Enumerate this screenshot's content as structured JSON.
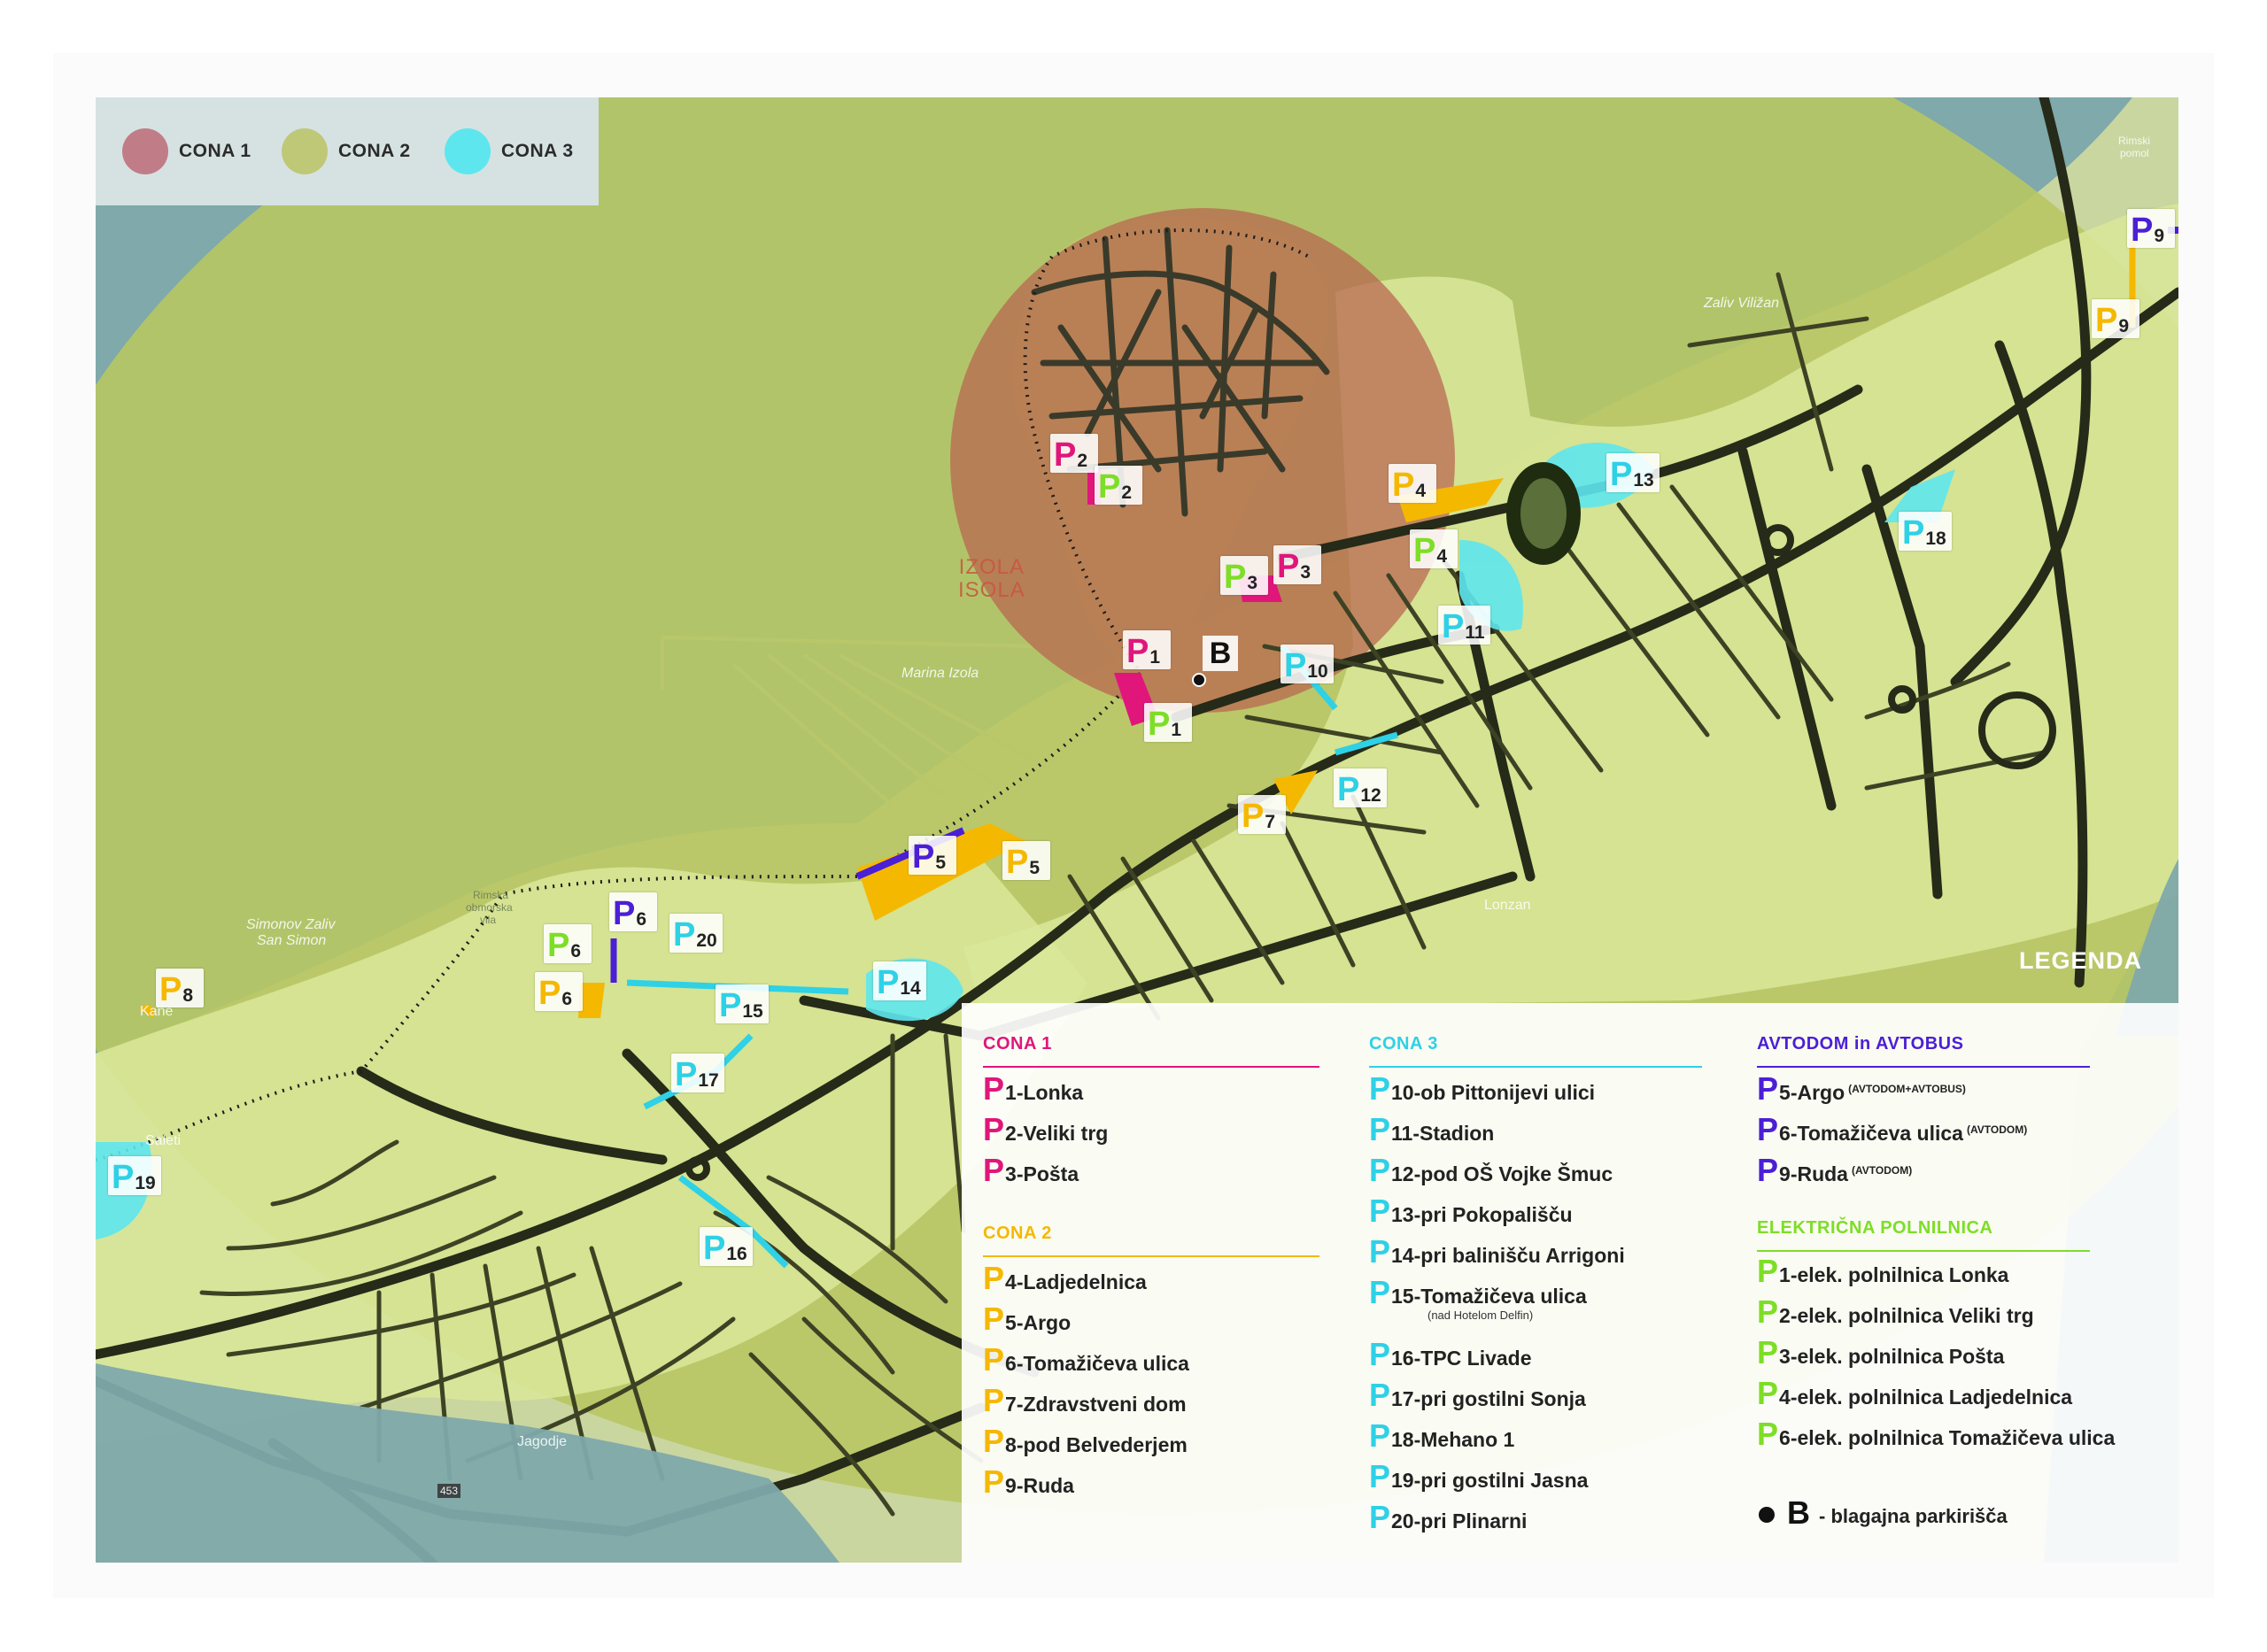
{
  "colors": {
    "sea": "#7fa9ab",
    "zone1": "#c07d88",
    "zone2": "#b8c763",
    "zone3": "#5ee6ee",
    "land": "#d9e89a",
    "cona1_accent": "#e0167b",
    "cona2_accent": "#f5b800",
    "cona3_accent": "#2ed1e6",
    "avtodom_accent": "#4b1fd6",
    "elec_accent": "#7dde26"
  },
  "zone_legend": [
    {
      "label": "CONA 1",
      "color": "#c07d88"
    },
    {
      "label": "CONA 2",
      "color": "#bfc877"
    },
    {
      "label": "CONA 3",
      "color": "#5ee6ee"
    }
  ],
  "legend_title": "LEGENDA",
  "places": {
    "izola": "IZOLA",
    "isola": "ISOLA",
    "marina": "Marina Izola",
    "zaliv_vilizan": "Zaliv Viližan",
    "simonov_zaliv": "Simonov Zaliv",
    "san_simon": "San Simon",
    "jagodje": "Jagodje",
    "kane": "Kane",
    "saleti": "Saleti",
    "lonzan": "Lonzan",
    "rimski_pomol_1": "Rimski",
    "rimski_pomol_2": "pomol",
    "rimska_vila_1": "Rimska",
    "rimska_vila_2": "obmorska",
    "rimska_vila_3": "vila",
    "road_453": "453"
  },
  "map_pins": [
    {
      "id": "cona1-1",
      "num": "1",
      "color": "#e0167b"
    },
    {
      "id": "cona1-2",
      "num": "2",
      "color": "#e0167b"
    },
    {
      "id": "cona1-3",
      "num": "3",
      "color": "#e0167b"
    },
    {
      "id": "elec-1",
      "num": "1",
      "color": "#7dde26"
    },
    {
      "id": "elec-2",
      "num": "2",
      "color": "#7dde26"
    },
    {
      "id": "elec-3",
      "num": "3",
      "color": "#7dde26"
    },
    {
      "id": "elec-4",
      "num": "4",
      "color": "#7dde26"
    },
    {
      "id": "elec-6",
      "num": "6",
      "color": "#7dde26"
    },
    {
      "id": "cona2-4",
      "num": "4",
      "color": "#f5b800"
    },
    {
      "id": "cona2-5",
      "num": "5",
      "color": "#f5b800"
    },
    {
      "id": "cona2-6",
      "num": "6",
      "color": "#f5b800"
    },
    {
      "id": "cona2-7",
      "num": "7",
      "color": "#f5b800"
    },
    {
      "id": "cona2-8",
      "num": "8",
      "color": "#f5b800"
    },
    {
      "id": "cona2-9",
      "num": "9",
      "color": "#f5b800"
    },
    {
      "id": "avto-5",
      "num": "5",
      "color": "#4b1fd6"
    },
    {
      "id": "avto-6",
      "num": "6",
      "color": "#4b1fd6"
    },
    {
      "id": "avto-9",
      "num": "9",
      "color": "#4b1fd6"
    },
    {
      "id": "cona3-10",
      "num": "10",
      "color": "#2ed1e6"
    },
    {
      "id": "cona3-11",
      "num": "11",
      "color": "#2ed1e6"
    },
    {
      "id": "cona3-12",
      "num": "12",
      "color": "#2ed1e6"
    },
    {
      "id": "cona3-13",
      "num": "13",
      "color": "#2ed1e6"
    },
    {
      "id": "cona3-14",
      "num": "14",
      "color": "#2ed1e6"
    },
    {
      "id": "cona3-15",
      "num": "15",
      "color": "#2ed1e6"
    },
    {
      "id": "cona3-16",
      "num": "16",
      "color": "#2ed1e6"
    },
    {
      "id": "cona3-17",
      "num": "17",
      "color": "#2ed1e6"
    },
    {
      "id": "cona3-18",
      "num": "18",
      "color": "#2ed1e6"
    },
    {
      "id": "cona3-19",
      "num": "19",
      "color": "#2ed1e6"
    },
    {
      "id": "cona3-20",
      "num": "20",
      "color": "#2ed1e6"
    }
  ],
  "cash_desk_marker": "B",
  "legend": {
    "cona1": {
      "title": "CONA 1",
      "color": "#e0167b",
      "items": [
        {
          "num": "1",
          "name": "-Lonka"
        },
        {
          "num": "2",
          "name": "-Veliki trg"
        },
        {
          "num": "3",
          "name": "-Pošta"
        }
      ]
    },
    "cona2": {
      "title": "CONA 2",
      "color": "#f5b800",
      "items": [
        {
          "num": "4",
          "name": "-Ladjedelnica"
        },
        {
          "num": "5",
          "name": "-Argo"
        },
        {
          "num": "6",
          "name": "-Tomažičeva ulica"
        },
        {
          "num": "7",
          "name": "-Zdravstveni dom"
        },
        {
          "num": "8",
          "name": "-pod Belvederjem"
        },
        {
          "num": "9",
          "name": "-Ruda"
        }
      ]
    },
    "cona3": {
      "title": "CONA 3",
      "color": "#2ed1e6",
      "items": [
        {
          "num": "10",
          "name": "-ob Pittonijevi ulici"
        },
        {
          "num": "11",
          "name": "-Stadion"
        },
        {
          "num": "12",
          "name": "-pod OŠ Vojke Šmuc"
        },
        {
          "num": "13",
          "name": "-pri Pokopališču"
        },
        {
          "num": "14",
          "name": "-pri balinišču Arrigoni"
        },
        {
          "num": "15",
          "name": "-Tomažičeva ulica"
        },
        {
          "num": "16",
          "name": "-TPC Livade"
        },
        {
          "num": "17",
          "name": "-pri gostilni Sonja"
        },
        {
          "num": "18",
          "name": "-Mehano 1"
        },
        {
          "num": "19",
          "name": "-pri gostilni Jasna"
        },
        {
          "num": "20",
          "name": "-pri Plinarni"
        }
      ],
      "note_15": "(nad Hotelom Delfin)"
    },
    "avtodom": {
      "title": "AVTODOM in AVTOBUS",
      "color": "#4b1fd6",
      "items": [
        {
          "num": "5",
          "name": "-Argo",
          "sup": "(AVTODOM+AVTOBUS)"
        },
        {
          "num": "6",
          "name": "-Tomažičeva ulica",
          "sup": "(AVTODOM)"
        },
        {
          "num": "9",
          "name": "-Ruda",
          "sup": "(AVTODOM)"
        }
      ]
    },
    "elec": {
      "title": "ELEKTRIČNA POLNILNICA",
      "color": "#7dde26",
      "items": [
        {
          "num": "1",
          "name": "-elek. polnilnica Lonka"
        },
        {
          "num": "2",
          "name": "-elek. polnilnica Veliki trg"
        },
        {
          "num": "3",
          "name": "-elek. polnilnica Pošta"
        },
        {
          "num": "4",
          "name": "-elek. polnilnica Ladjedelnica"
        },
        {
          "num": "6",
          "name": "-elek. polnilnica Tomažičeva ulica"
        }
      ]
    },
    "cash": {
      "letter": "B",
      "text": "- blagajna parkirišča"
    }
  }
}
